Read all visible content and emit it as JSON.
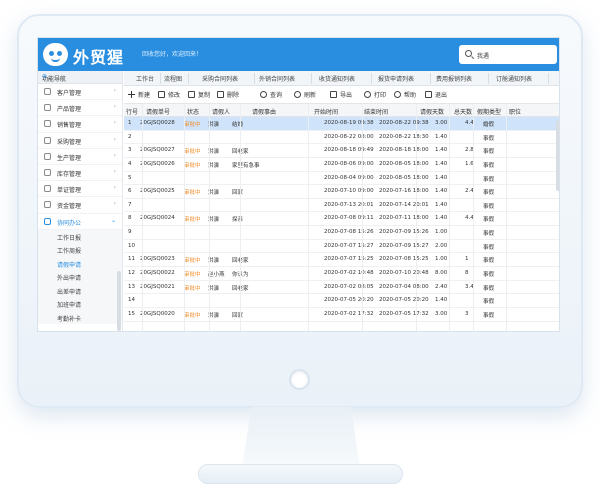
{
  "header": {
    "brand": "外贸猩",
    "welcome": "回收您好，欢迎回来！",
    "search_value": "我遇"
  },
  "sidebar": {
    "title": "功能导航",
    "items": [
      {
        "label": "客户管理",
        "icon": "customer-icon",
        "open": false
      },
      {
        "label": "产品管理",
        "icon": "product-icon",
        "open": false
      },
      {
        "label": "销售管理",
        "icon": "sales-icon",
        "open": false
      },
      {
        "label": "采购管理",
        "icon": "purchase-icon",
        "open": false
      },
      {
        "label": "生产管理",
        "icon": "production-icon",
        "open": false
      },
      {
        "label": "库存管理",
        "icon": "inventory-icon",
        "open": false
      },
      {
        "label": "单证管理",
        "icon": "document-icon",
        "open": false
      },
      {
        "label": "资金管理",
        "icon": "finance-icon",
        "open": false
      },
      {
        "label": "协同办公",
        "icon": "office-icon",
        "open": true
      }
    ],
    "subitems": [
      {
        "label": "工作日报",
        "active": false
      },
      {
        "label": "工作周报",
        "active": false
      },
      {
        "label": "请假申请",
        "active": true
      },
      {
        "label": "外出申请",
        "active": false
      },
      {
        "label": "出差申请",
        "active": false
      },
      {
        "label": "加班申请",
        "active": false
      },
      {
        "label": "考勤补卡",
        "active": false
      }
    ]
  },
  "tabs": [
    "工作台",
    "流程图",
    "采购合同列表",
    "外销合同列表",
    "收货通知列表",
    "报货申请列表",
    "费用报销列表",
    "订舱通知列表"
  ],
  "toolbar": [
    "新建",
    "修改",
    "复制",
    "删除",
    "查询",
    "刷新",
    "导出",
    "打印",
    "帮助",
    "退出"
  ],
  "columns": [
    "行号",
    "请假单号",
    "状态",
    "请假人",
    "请假事由",
    "开始时间",
    "结束时间",
    "请假天数",
    "总天数",
    "假期类型",
    "职位"
  ],
  "rows": [
    {
      "n": "1",
      "no": "20GJSQ0028",
      "status": "审批中",
      "person": "洪濞",
      "reason": "结婚",
      "start": "2020-08-19 09:38",
      "end": "2020-08-22 09:38",
      "days": "3.00",
      "total": "4.4",
      "type": "婚假",
      "selected": true
    },
    {
      "n": "2",
      "no": "",
      "status": "",
      "person": "",
      "reason": "",
      "start": "2020-08-22 08:00",
      "end": "2020-08-22 18:30",
      "days": "1.40",
      "total": "",
      "type": "事假",
      "selected": false
    },
    {
      "n": "3",
      "no": "20GJSQ0027",
      "status": "审批中",
      "person": "洪濞",
      "reason": "回老家",
      "start": "2020-08-18 09:49",
      "end": "2020-08-18 18:00",
      "days": "1.40",
      "total": "2.8",
      "type": "事假",
      "selected": false
    },
    {
      "n": "4",
      "no": "20GJSQ0026",
      "status": "审批中",
      "person": "洪濞",
      "reason": "家里有急事",
      "start": "2020-08-06 09:00",
      "end": "2020-08-05 18:00",
      "days": "1.40",
      "total": "1.6",
      "type": "事假",
      "selected": false
    },
    {
      "n": "5",
      "no": "",
      "status": "",
      "person": "",
      "reason": "",
      "start": "2020-08-04 09:00",
      "end": "2020-08-05 18:00",
      "days": "1.40",
      "total": "",
      "type": "事假",
      "selected": false
    },
    {
      "n": "6",
      "no": "20GJSQ0025",
      "status": "审批中",
      "person": "洪濞",
      "reason": "回家",
      "start": "2020-07-10 09:00",
      "end": "2020-07-16 18:00",
      "days": "1.40",
      "total": "2.4",
      "type": "事假",
      "selected": false
    },
    {
      "n": "7",
      "no": "",
      "status": "",
      "person": "",
      "reason": "",
      "start": "2020-07-13 20:01",
      "end": "2020-07-14 20:01",
      "days": "1.40",
      "total": "",
      "type": "事假",
      "selected": false
    },
    {
      "n": "8",
      "no": "20GJSQ0024",
      "status": "审批中",
      "person": "洪濞",
      "reason": "探亲",
      "start": "2020-07-08 09:11",
      "end": "2020-07-11 18:00",
      "days": "1.40",
      "total": "4.4",
      "type": "事假",
      "selected": false
    },
    {
      "n": "9",
      "no": "",
      "status": "",
      "person": "",
      "reason": "",
      "start": "2020-07-08 15:26",
      "end": "2020-07-09 15:26",
      "days": "1.00",
      "total": "",
      "type": "事假",
      "selected": false
    },
    {
      "n": "10",
      "no": "",
      "status": "",
      "person": "",
      "reason": "",
      "start": "2020-07-07 15:27",
      "end": "2020-07-09 15:27",
      "days": "2.00",
      "total": "",
      "type": "事假",
      "selected": false
    },
    {
      "n": "11",
      "no": "20GJSQ0023",
      "status": "审批中",
      "person": "洪濞",
      "reason": "回老家",
      "start": "2020-07-07 15:25",
      "end": "2020-07-08 15:25",
      "days": "1.00",
      "total": "1",
      "type": "事假",
      "selected": false
    },
    {
      "n": "12",
      "no": "20GJSQ0022",
      "status": "审批中",
      "person": "赵小燕",
      "reason": "你认为",
      "start": "2020-07-02 10:48",
      "end": "2020-07-10 20:48",
      "days": "8.00",
      "total": "8",
      "type": "事假",
      "selected": false
    },
    {
      "n": "13",
      "no": "20GJSQ0021",
      "status": "审批中",
      "person": "洪濞",
      "reason": "回老家",
      "start": "2020-07-02 08:05",
      "end": "2020-07-04 08:00",
      "days": "2.40",
      "total": "3.4",
      "type": "事假",
      "selected": false
    },
    {
      "n": "14",
      "no": "",
      "status": "",
      "person": "",
      "reason": "",
      "start": "2020-07-05 20:20",
      "end": "2020-07-05 20:20",
      "days": "1.40",
      "total": "",
      "type": "事假",
      "selected": false
    },
    {
      "n": "15",
      "no": "20GJSQ0020",
      "status": "审批中",
      "person": "洪濞",
      "reason": "回家",
      "start": "2020-07-02 17:32",
      "end": "2020-07-05 17:32",
      "days": "3.00",
      "total": "3",
      "type": "事假",
      "selected": false
    }
  ]
}
